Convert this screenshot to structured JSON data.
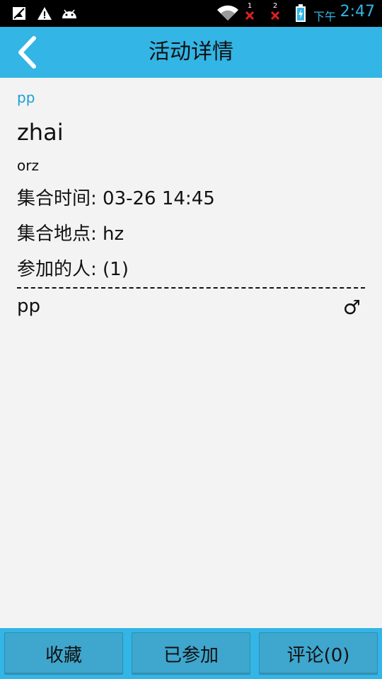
{
  "status_bar": {
    "icons": [
      "no-sim-icon",
      "warning-icon",
      "android-icon",
      "wifi-icon",
      "signal-1-off-icon",
      "signal-2-off-icon",
      "battery-charging-icon"
    ],
    "sim1_label": "1",
    "sim2_label": "2",
    "ampm": "下午",
    "time": "2:47"
  },
  "action_bar": {
    "title": "活动详情",
    "back_icon": "chevron-left-icon"
  },
  "activity": {
    "owner": "pp",
    "name": "zhai",
    "description": "orz",
    "meet_time_label": "集合时间: ",
    "meet_time_value": "03-26 14:45",
    "meet_place_label": "集合地点: ",
    "meet_place_value": "hz",
    "participants_label": "参加的人: ",
    "participants_count": "(1)"
  },
  "participants": [
    {
      "name": "pp",
      "gender_icon": "male-icon",
      "gender_symbol": "♂"
    }
  ],
  "bottom_bar": {
    "favorite_label": "收藏",
    "joined_label": "已参加",
    "comment_label": "评论(0)"
  },
  "colors": {
    "accent": "#33b5e5",
    "button": "#3fa6cd",
    "owner_text": "#1a9fd6",
    "background": "#f3f3f3"
  }
}
